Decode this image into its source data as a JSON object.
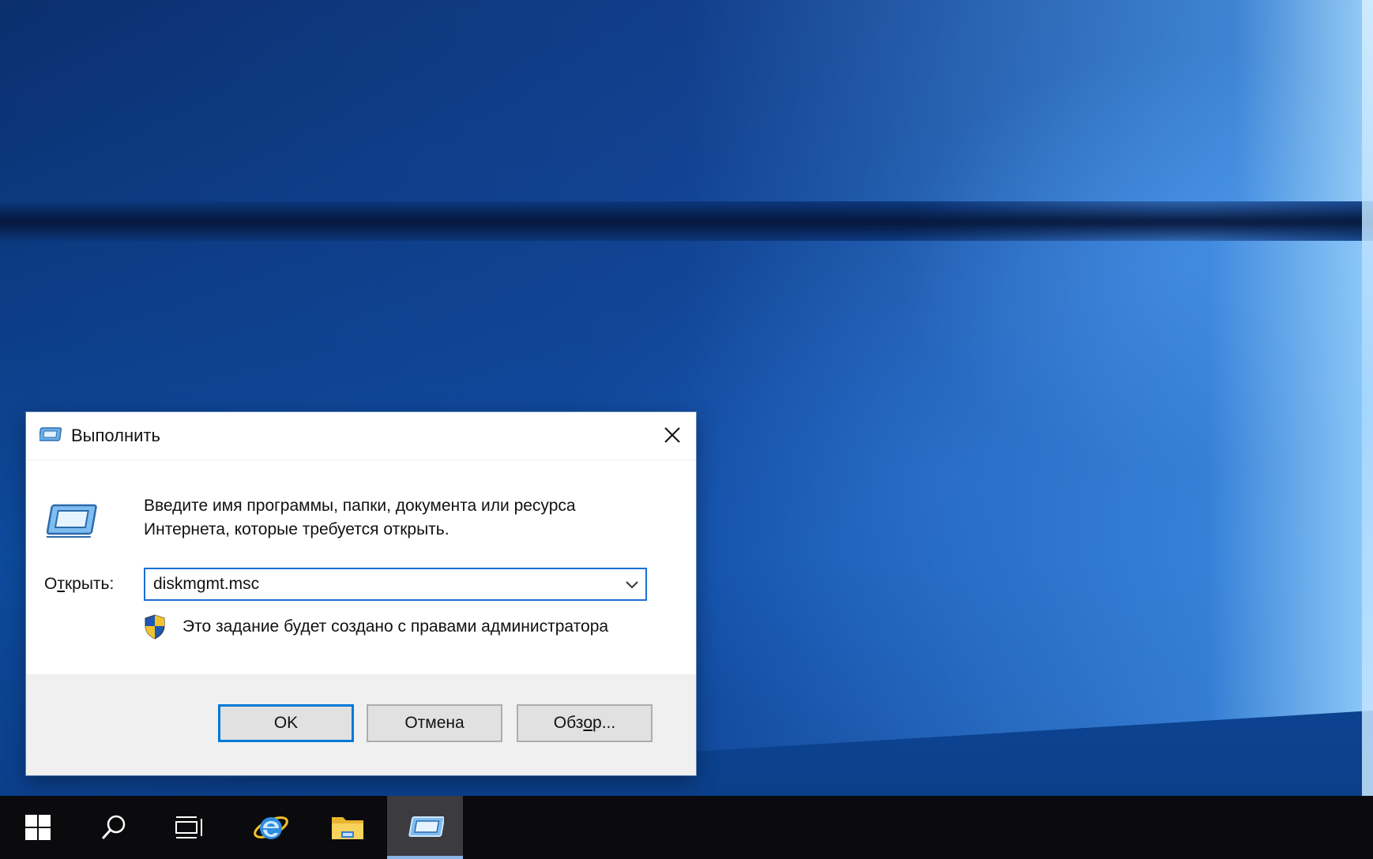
{
  "dialog": {
    "title": "Выполнить",
    "instruction_line1": "Введите имя программы, папки, документа или ресурса",
    "instruction_line2": "Интернета, которые требуется открыть.",
    "open_label_prefix": "О",
    "open_label_accel": "т",
    "open_label_rest": "крыть:",
    "open_value": "diskmgmt.msc",
    "admin_note": "Это задание будет создано с правами администратора",
    "ok_label": "OK",
    "cancel_label": "Отмена",
    "browse_prefix": "Обз",
    "browse_accel": "о",
    "browse_rest": "р..."
  },
  "icons": {
    "title": "run-icon",
    "big": "run-icon",
    "close": "close-icon",
    "dropdown": "chevron-down-icon",
    "shield": "uac-shield-icon"
  },
  "taskbar": {
    "items": [
      {
        "name": "start",
        "icon": "windows-logo-icon"
      },
      {
        "name": "search",
        "icon": "search-icon"
      },
      {
        "name": "task-view",
        "icon": "task-view-icon"
      },
      {
        "name": "internet-explorer",
        "icon": "internet-explorer-icon"
      },
      {
        "name": "file-explorer",
        "icon": "folder-icon"
      },
      {
        "name": "run",
        "icon": "run-icon",
        "active": true
      }
    ]
  },
  "colors": {
    "accent": "#0078d7",
    "taskbar": "#0b0b0e",
    "desktop": "#0c3d86"
  }
}
